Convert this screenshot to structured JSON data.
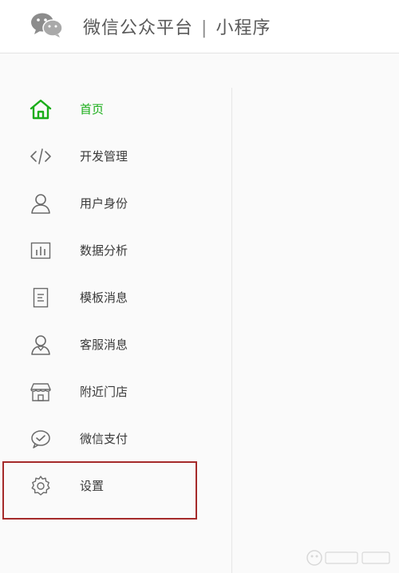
{
  "header": {
    "brand": "微信公众平台",
    "separator": "|",
    "product": "小程序"
  },
  "sidebar": {
    "items": [
      {
        "label": "首页",
        "icon": "home-icon",
        "active": true
      },
      {
        "label": "开发管理",
        "icon": "code-icon",
        "active": false
      },
      {
        "label": "用户身份",
        "icon": "user-icon",
        "active": false
      },
      {
        "label": "数据分析",
        "icon": "chart-icon",
        "active": false
      },
      {
        "label": "模板消息",
        "icon": "document-icon",
        "active": false
      },
      {
        "label": "客服消息",
        "icon": "customer-service-icon",
        "active": false
      },
      {
        "label": "附近门店",
        "icon": "store-icon",
        "active": false
      },
      {
        "label": "微信支付",
        "icon": "wechat-pay-icon",
        "active": false
      },
      {
        "label": "设置",
        "icon": "gear-icon",
        "active": false
      }
    ]
  },
  "colors": {
    "accent": "#1aad19",
    "text": "#3a3a3a",
    "icon": "#6a6a6a",
    "highlight": "#a52a2a"
  }
}
